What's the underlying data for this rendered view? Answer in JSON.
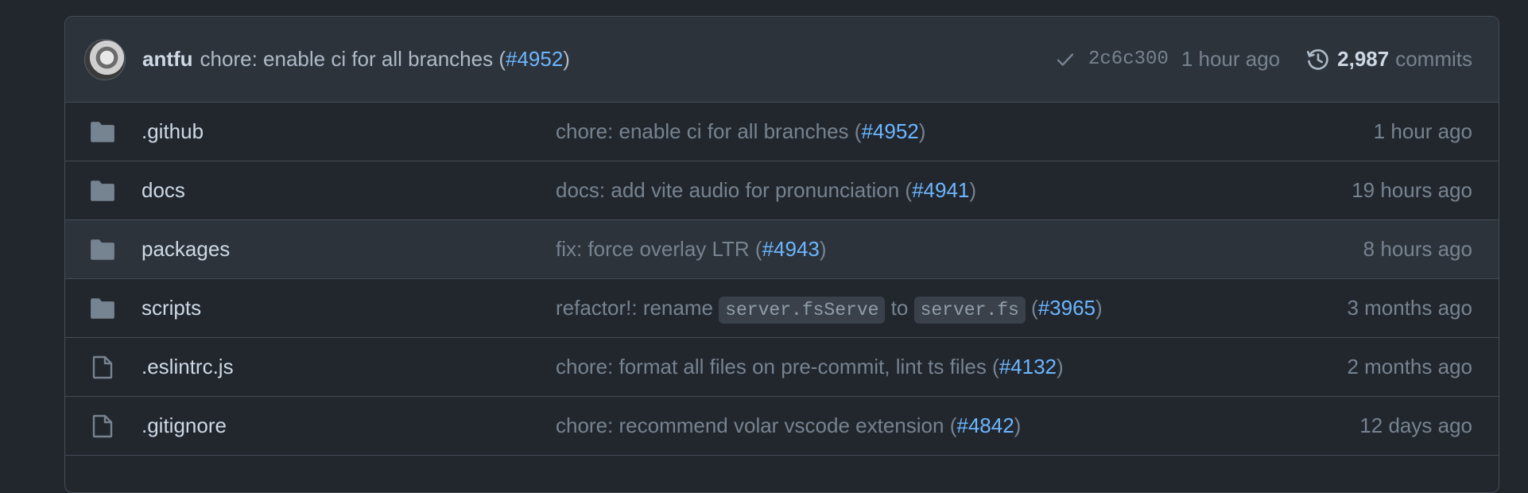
{
  "latest_commit": {
    "author": "antfu",
    "message": "chore: enable ci for all branches (",
    "pr": "#4952",
    "message_end": ")",
    "sha": "2c6c300",
    "time": "1 hour ago",
    "commit_count": "2,987",
    "commit_label": "commits"
  },
  "files": [
    {
      "type": "folder",
      "name": ".github",
      "msg_before": "chore: enable ci for all branches (",
      "pr": "#4952",
      "msg_after": ")",
      "time": "1 hour ago"
    },
    {
      "type": "folder",
      "name": "docs",
      "msg_before": "docs: add vite audio for pronunciation (",
      "pr": "#4941",
      "msg_after": ")",
      "time": "19 hours ago"
    },
    {
      "type": "folder",
      "name": "packages",
      "msg_before": "fix: force overlay LTR (",
      "pr": "#4943",
      "msg_after": ")",
      "time": "8 hours ago"
    },
    {
      "type": "folder",
      "name": "scripts",
      "msg_before": "refactor!: rename ",
      "code1": "server.fsServe",
      "msg_mid": " to ",
      "code2": "server.fs",
      "msg_pre_pr": " (",
      "pr": "#3965",
      "msg_after": ")",
      "time": "3 months ago"
    },
    {
      "type": "file",
      "name": ".eslintrc.js",
      "msg_before": "chore: format all files on pre-commit, lint ts files (",
      "pr": "#4132",
      "msg_after": ")",
      "time": "2 months ago"
    },
    {
      "type": "file",
      "name": ".gitignore",
      "msg_before": "chore: recommend volar vscode extension (",
      "pr": "#4842",
      "msg_after": ")",
      "time": "12 days ago"
    }
  ],
  "colors": {
    "background": "#22272e",
    "header_bg": "#2d333b",
    "border": "#444c56",
    "link": "#6cb6ff",
    "muted": "#768390",
    "text": "#adbac7"
  }
}
